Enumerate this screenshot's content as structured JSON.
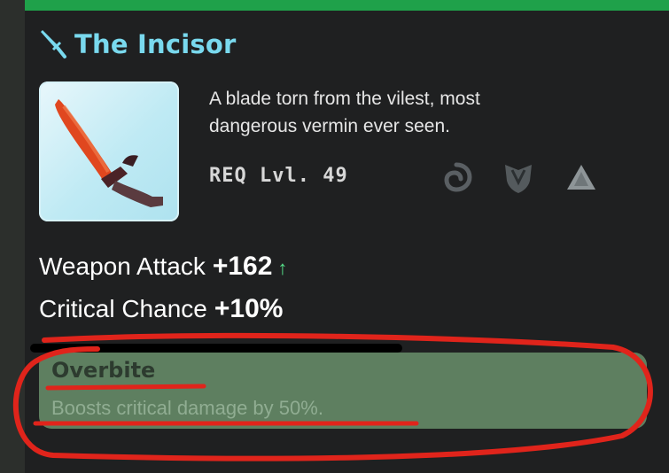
{
  "item": {
    "name": "The Incisor",
    "description_line1": "A blade torn from the vilest, most",
    "description_line2": "dangerous vermin ever seen.",
    "requirement": "REQ Lvl. 49",
    "class_icons": [
      "swirl-icon",
      "shield-icon",
      "arrowhead-icon"
    ],
    "title_icon": "dagger-icon"
  },
  "stats": [
    {
      "label": "Weapon Attack",
      "value": "+162",
      "arrow": "↑"
    },
    {
      "label": "Critical Chance",
      "value": "+10%"
    }
  ],
  "ability": {
    "name": "Overbite",
    "description": "Boosts critical damage by 50%."
  },
  "colors": {
    "title": "#79d9ee",
    "panel": "#1f2021",
    "ability_bg": "#5e7f60",
    "annotation": "#e0241b",
    "arrow_up": "#56e08a"
  }
}
